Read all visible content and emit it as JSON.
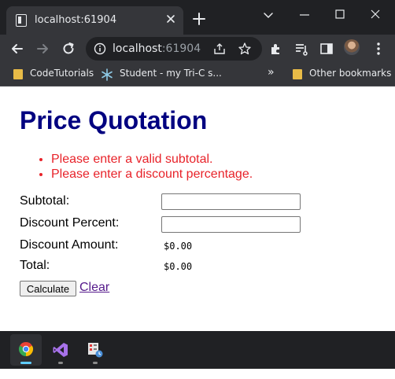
{
  "browser": {
    "tab_title": "localhost:61904",
    "address_host": "localhost",
    "address_port": ":61904",
    "bookmarks": [
      {
        "label": "CodeTutorials",
        "icon": "folder-icon"
      },
      {
        "label": "Student - my Tri-C s...",
        "icon": "snowflake-icon"
      }
    ],
    "bookmarks_overflow": "»",
    "other_bookmarks": "Other bookmarks"
  },
  "page": {
    "title": "Price Quotation",
    "errors": [
      "Please enter a valid subtotal.",
      "Please enter a discount percentage."
    ],
    "fields": {
      "subtotal_label": "Subtotal:",
      "subtotal_value": "",
      "discount_percent_label": "Discount Percent:",
      "discount_percent_value": "",
      "discount_amount_label": "Discount Amount:",
      "discount_amount_value": "$0.00",
      "total_label": "Total:",
      "total_value": "$0.00"
    },
    "calculate_label": "Calculate",
    "clear_label": "Clear"
  },
  "colors": {
    "title": "#000080",
    "error": "#e8232a",
    "link_visited": "#551a8b",
    "chrome_dark": "#202124",
    "chrome_toolbar": "#35363a"
  },
  "taskbar": {
    "apps": [
      {
        "name": "chrome",
        "icon": "chrome-icon",
        "active": true
      },
      {
        "name": "visual-studio",
        "icon": "visual-studio-icon",
        "active": false
      },
      {
        "name": "app",
        "icon": "app-icon",
        "active": false
      }
    ]
  }
}
